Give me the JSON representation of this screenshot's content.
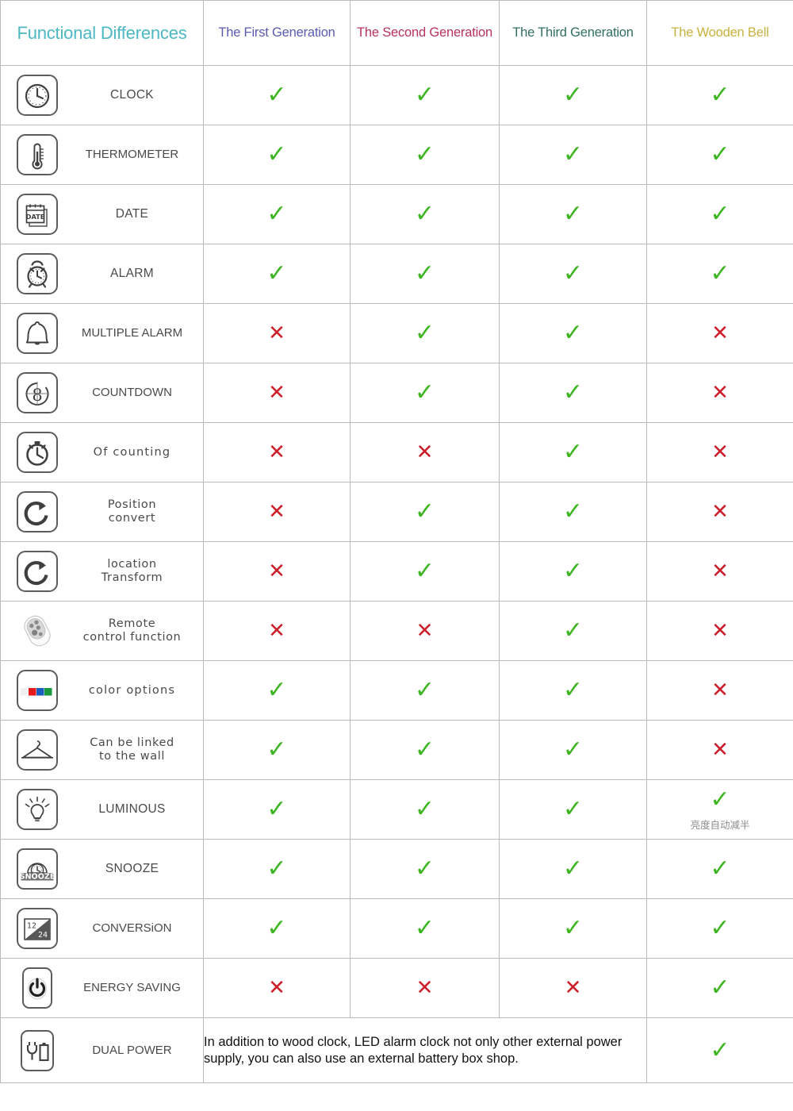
{
  "header": {
    "title": "Functional Differences",
    "columns": [
      {
        "label": "The First Generation",
        "color": "#5a5ab0"
      },
      {
        "label": "The Second Generation",
        "color": "#b83060"
      },
      {
        "label": "The Third Generation",
        "color": "#2f6f60"
      },
      {
        "label": "The Wooden Bell",
        "color": "#c8b13e"
      }
    ],
    "title_color": "#4bb8c4"
  },
  "marks": {
    "yes": "✓",
    "no": "✕",
    "yes_color": "#3cb521",
    "no_color": "#cc1f2a"
  },
  "rows": [
    {
      "icon": "clock-icon",
      "label": "CLOCK",
      "values": [
        "yes",
        "yes",
        "yes",
        "yes"
      ]
    },
    {
      "icon": "thermometer-icon",
      "label": "THERMOMETER",
      "values": [
        "yes",
        "yes",
        "yes",
        "yes"
      ]
    },
    {
      "icon": "calendar-date-icon",
      "label": "DATE",
      "values": [
        "yes",
        "yes",
        "yes",
        "yes"
      ]
    },
    {
      "icon": "alarm-clock-icon",
      "label": "ALARM",
      "values": [
        "yes",
        "yes",
        "yes",
        "yes"
      ]
    },
    {
      "icon": "bell-icon",
      "label": "MULTIPLE ALARM",
      "values": [
        "no",
        "yes",
        "yes",
        "no"
      ]
    },
    {
      "icon": "countdown-icon",
      "label": "COUNTDOWN",
      "values": [
        "no",
        "yes",
        "yes",
        "no"
      ]
    },
    {
      "icon": "stopwatch-icon",
      "label": "Of counting",
      "values": [
        "no",
        "no",
        "yes",
        "no"
      ]
    },
    {
      "icon": "rotate-icon",
      "label": "Position\nconvert",
      "values": [
        "no",
        "yes",
        "yes",
        "no"
      ]
    },
    {
      "icon": "rotate-icon",
      "label": "location\nTransform",
      "values": [
        "no",
        "yes",
        "yes",
        "no"
      ]
    },
    {
      "icon": "remote-control-icon",
      "label": "Remote\ncontrol function",
      "values": [
        "no",
        "no",
        "yes",
        "no"
      ]
    },
    {
      "icon": "color-swatches-icon",
      "label": "color options",
      "values": [
        "yes",
        "yes",
        "yes",
        "no"
      ]
    },
    {
      "icon": "clothes-hanger-icon",
      "label": "Can be linked\nto the wall",
      "values": [
        "yes",
        "yes",
        "yes",
        "no"
      ]
    },
    {
      "icon": "light-bulb-icon",
      "label": "LUMINOUS",
      "values": [
        "yes",
        "yes",
        "yes",
        "yes"
      ],
      "note_col4": "亮度自动减半"
    },
    {
      "icon": "snooze-icon",
      "label": "SNOOZE",
      "values": [
        "yes",
        "yes",
        "yes",
        "yes"
      ]
    },
    {
      "icon": "hour-format-icon",
      "label": "CONVERSiON",
      "values": [
        "yes",
        "yes",
        "yes",
        "yes"
      ]
    },
    {
      "icon": "power-button-icon",
      "label": "ENERGY SAVING",
      "values": [
        "no",
        "no",
        "no",
        "yes"
      ]
    },
    {
      "icon": "plug-battery-icon",
      "label": "DUAL POWER",
      "spanned_note": "In addition to wood clock, LED alarm clock not only other external power supply, you can also use an external battery box shop.",
      "values": [
        "yes"
      ]
    }
  ],
  "swatch_colors": [
    "#f0f0f0",
    "#e8191b",
    "#1a5fc0",
    "#1a9a3a"
  ]
}
